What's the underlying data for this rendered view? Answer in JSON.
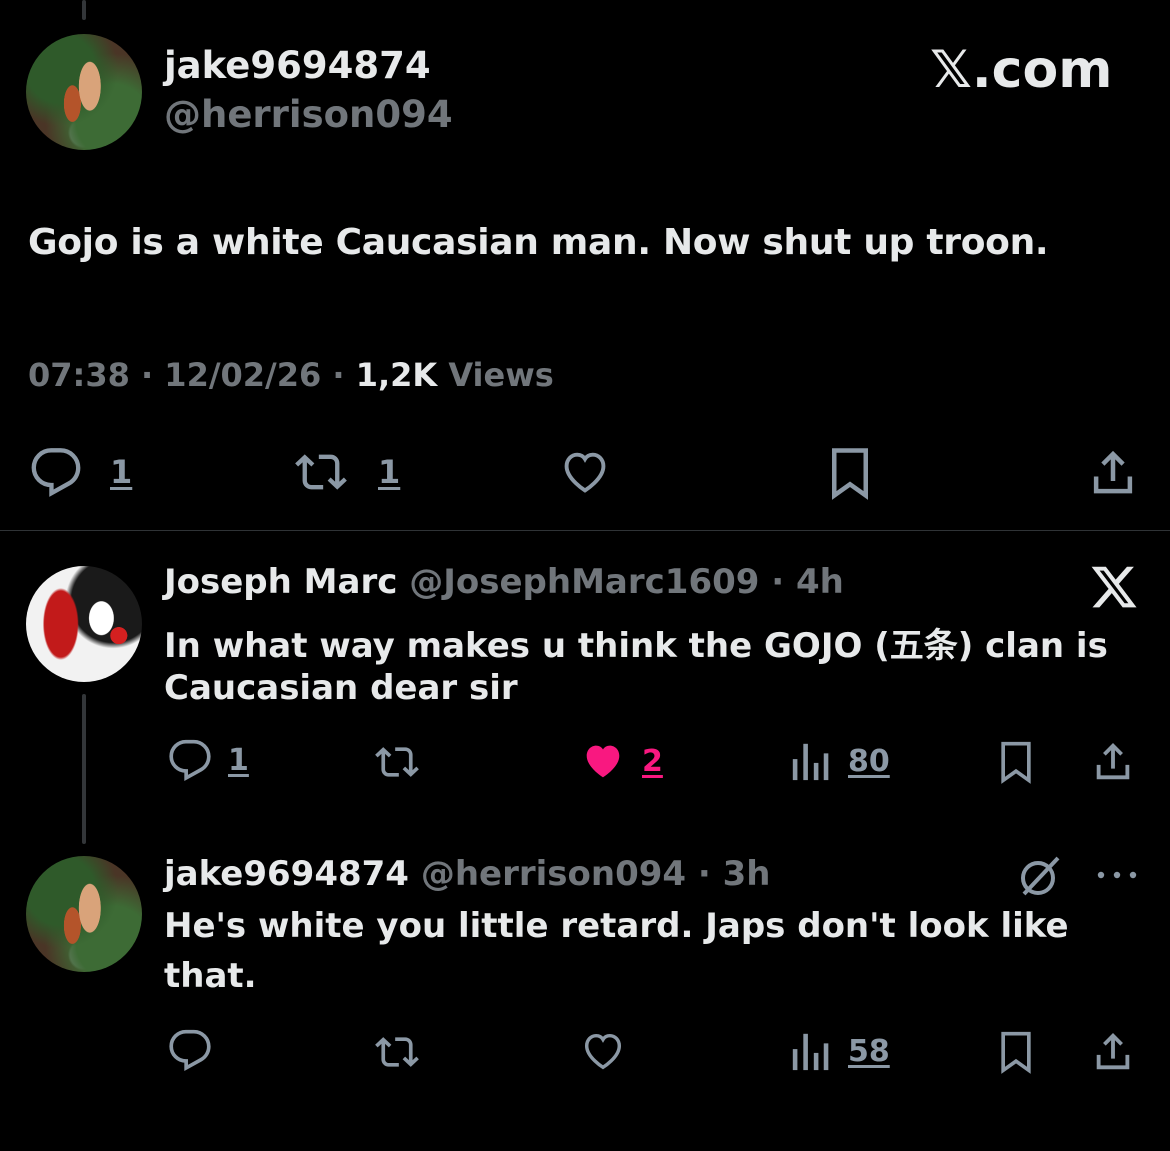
{
  "main_tweet": {
    "display_name": "jake9694874",
    "handle": "@herrison094",
    "brand": "𝕏.com",
    "text": "Gojo is a white Caucasian man. Now shut up troon.",
    "time": "07:38",
    "date": "12/02/26",
    "views_count": "1,2K",
    "views_label": "Views",
    "reply_count": "1",
    "retweet_count": "1",
    "avatar_icon": "snake-avatar"
  },
  "replies": [
    {
      "display_name": "Joseph Marc",
      "handle": "@JosephMarc1609",
      "age": "4h",
      "text_line1": "In what way makes u think the GOJO (五条) clan is",
      "text_line2": "Caucasian dear sir",
      "reply_count": "1",
      "like_count": "2",
      "views_count": "80",
      "liked": true,
      "like_color": "#f91880",
      "corner_icon": "x-logo-icon",
      "avatar_icon": "anime-avatar"
    },
    {
      "display_name": "jake9694874",
      "handle": "@herrison094",
      "age": "3h",
      "text_line1": "He's white you little retard. Japs don't look like",
      "text_line2": "that.",
      "views_count": "58",
      "liked": false,
      "corner_icon": "grok-icon",
      "more_icon": "more-dots-icon",
      "avatar_icon": "snake-avatar"
    }
  ]
}
